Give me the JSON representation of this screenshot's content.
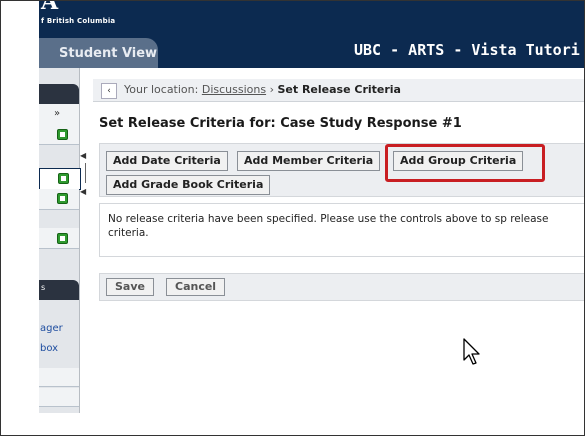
{
  "banner": {
    "logo": "A",
    "subtitle": "f British Columbia",
    "student_view_tab": "Student View",
    "course_title": "UBC - ARTS - Vista Tutori"
  },
  "sidebar": {
    "labels": [
      "ager",
      "box"
    ],
    "fragment": "s"
  },
  "location": {
    "prefix": "Your location:",
    "link": "Discussions",
    "separator": "›",
    "current": "Set Release Criteria"
  },
  "page_title": "Set Release Criteria for: Case Study Response #1",
  "criteria_buttons": {
    "add_date": "Add Date Criteria",
    "add_member": "Add Member Criteria",
    "add_group": "Add Group Criteria",
    "add_grade_book": "Add Grade Book Criteria"
  },
  "message": "No release criteria have been specified. Please use the controls above to sp release criteria.",
  "actions": {
    "save": "Save",
    "cancel": "Cancel"
  },
  "colors": {
    "banner": "#0c2a50",
    "highlight": "#c81e22",
    "plus_green": "#2f9a2f"
  }
}
